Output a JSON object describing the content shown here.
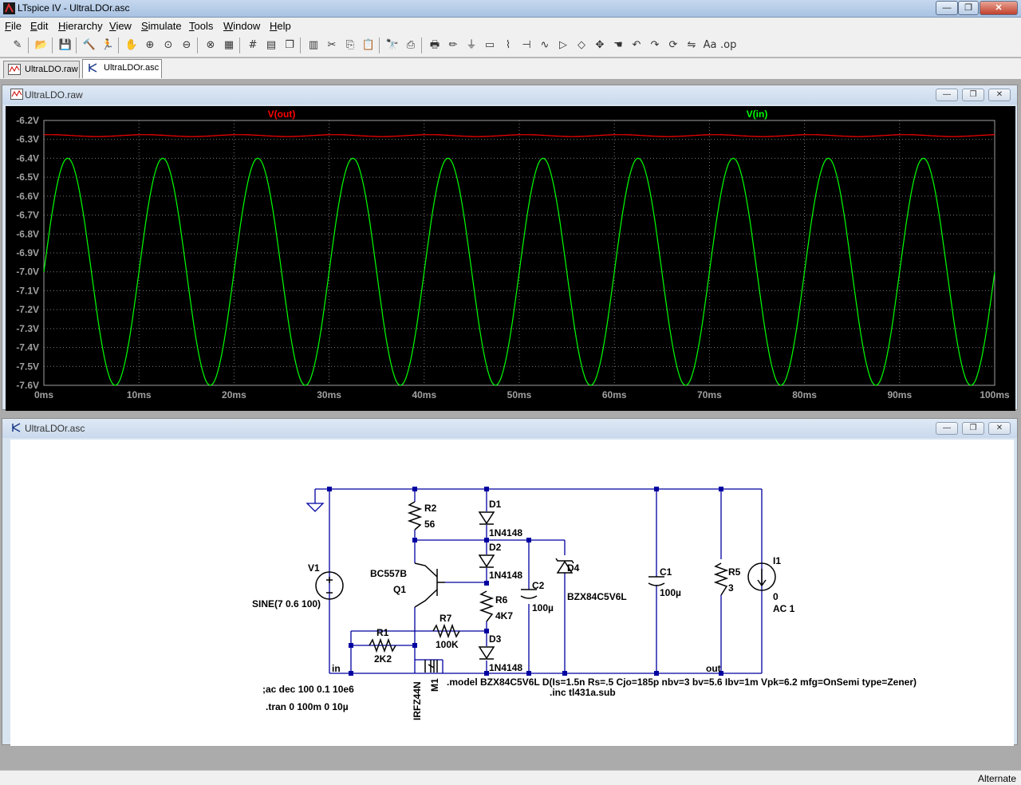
{
  "app": {
    "title": "LTspice IV - UltraLDOr.asc"
  },
  "window_controls": {
    "minimize": "—",
    "maximize": "❐",
    "close": "✕"
  },
  "menu": [
    {
      "label": "File",
      "underline": "F",
      "rest": "ile"
    },
    {
      "label": "Edit",
      "underline": "E",
      "rest": "dit"
    },
    {
      "label": "Hierarchy",
      "underline": "H",
      "rest": "ierarchy"
    },
    {
      "label": "View",
      "underline": "V",
      "rest": "iew"
    },
    {
      "label": "Simulate",
      "underline": "S",
      "rest": "imulate"
    },
    {
      "label": "Tools",
      "underline": "T",
      "rest": "ools"
    },
    {
      "label": "Window",
      "underline": "W",
      "rest": "indow"
    },
    {
      "label": "Help",
      "underline": "H",
      "rest": "elp"
    }
  ],
  "toolbar_icons": [
    "new-schematic-icon",
    "open-icon",
    "save-icon",
    "control-panel-icon",
    "run-icon",
    "pan-icon",
    "zoom-in-icon",
    "zoom-full-icon",
    "zoom-out-icon",
    "zoom-cancel-icon",
    "autorange-icon",
    "grid-icon",
    "tile-horizontal-icon",
    "cascade-icon",
    "tile-vertical-icon",
    "cut-icon",
    "copy-icon",
    "paste-icon",
    "find-icon",
    "print-preview-icon",
    "print-icon",
    "wire-icon",
    "ground-icon",
    "label-icon",
    "resistor-icon",
    "capacitor-icon",
    "inductor-icon",
    "diode-icon",
    "component-icon",
    "move-icon",
    "drag-icon",
    "undo-icon",
    "redo-icon",
    "rotate-icon",
    "mirror-icon",
    "text-icon",
    "spice-directive-icon"
  ],
  "tabs": [
    {
      "label": "UltraLDO.raw",
      "icon": "waveform-icon"
    },
    {
      "label": "UltraLDOr.asc",
      "icon": "schematic-icon"
    }
  ],
  "waveform_window": {
    "title": "UltraLDO.raw"
  },
  "schematic_window": {
    "title": "UltraLDOr.asc"
  },
  "chart_data": {
    "type": "line",
    "title": "",
    "xlabel": "",
    "ylabel": "",
    "xlim": [
      0,
      100
    ],
    "ylim": [
      -7.6,
      -6.2
    ],
    "x_ticks": [
      "0ms",
      "10ms",
      "20ms",
      "30ms",
      "40ms",
      "50ms",
      "60ms",
      "70ms",
      "80ms",
      "90ms",
      "100ms"
    ],
    "y_ticks": [
      "-6.2V",
      "-6.3V",
      "-6.4V",
      "-6.5V",
      "-6.6V",
      "-6.7V",
      "-6.8V",
      "-6.9V",
      "-7.0V",
      "-7.1V",
      "-7.2V",
      "-7.3V",
      "-7.4V",
      "-7.5V",
      "-7.6V"
    ],
    "grid": true,
    "series": [
      {
        "name": "V(out)",
        "color": "#ff0000",
        "shape": "dc",
        "offset": -6.28,
        "ripple": 0.005,
        "freq_hz": 100
      },
      {
        "name": "V(in)",
        "color": "#00ff00",
        "shape": "sine",
        "offset": -7.0,
        "amplitude": 0.6,
        "freq_hz": 100,
        "phase": "sin"
      }
    ]
  },
  "schematic": {
    "labels": {
      "V1": "V1",
      "V1_value": "SINE(7 0.6 100)",
      "R2": "R2",
      "R2_value": "56",
      "D1": "D1",
      "D1_model": "1N4148",
      "D2": "D2",
      "D2_model": "1N4148",
      "D3": "D3",
      "D3_model": "1N4148",
      "Q1_model": "BC557B",
      "Q1": "Q1",
      "R6": "R6",
      "R6_value": "4K7",
      "R7": "R7",
      "R7_value": "100K",
      "R1": "R1",
      "R1_value": "2K2",
      "C2": "C2",
      "C2_value": "100µ",
      "D4": "D4",
      "D4_model": "BZX84C5V6L",
      "C1": "C1",
      "C1_value": "100µ",
      "R5": "R5",
      "R5_value": "3",
      "I1": "I1",
      "I1_value": "0",
      "I1_ac": "AC 1",
      "M1": "M1",
      "M1_model": "IRFZ44N",
      "net_in": "in",
      "net_out": "out"
    },
    "directives": {
      "ac": ";ac dec 100 0.1 10e6",
      "tran": ".tran 0 100m 0 10µ",
      "model": ".model BZX84C5V6L D(Is=1.5n Rs=.5 Cjo=185p nbv=3 bv=5.6 Ibv=1m Vpk=6.2 mfg=OnSemi type=Zener)",
      "inc": ".inc tl431a.sub"
    }
  },
  "status": {
    "text": "Alternate"
  }
}
